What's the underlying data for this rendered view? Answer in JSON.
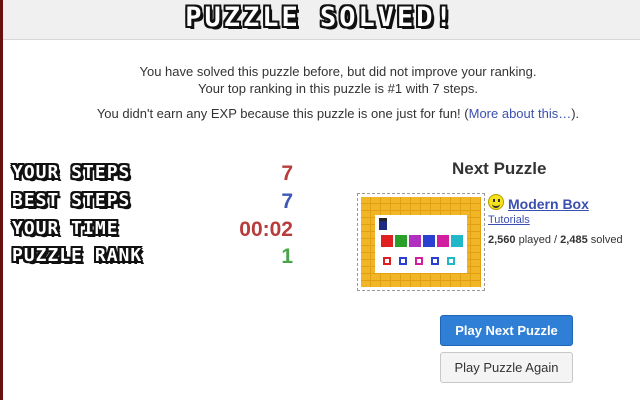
{
  "title": "PUZZLE SOLVED!",
  "messages": {
    "line1": "You have solved this puzzle before, but did not improve your ranking.",
    "line2": "Your top ranking in this puzzle is #1 with 7 steps.",
    "line3_prefix": "You didn't earn any EXP because this puzzle is one just for fun! (",
    "line3_link": "More about this…",
    "line3_suffix": ")."
  },
  "stats": [
    {
      "label": "YOUR STEPS",
      "value": "7",
      "color": "#b83c3c"
    },
    {
      "label": "BEST STEPS",
      "value": "7",
      "color": "#3f55b8"
    },
    {
      "label": "YOUR TIME",
      "value": "00:02",
      "color": "#b83c3c"
    },
    {
      "label": "PUZZLE RANK",
      "value": "1",
      "color": "#4aa24a"
    }
  ],
  "next_puzzle": {
    "heading": "Next Puzzle",
    "name": "Modern Box",
    "category": "Tutorials",
    "played_count": "2,560",
    "played_label": " played / ",
    "solved_count": "2,485",
    "solved_label": " solved",
    "icon": "smiley-icon"
  },
  "buttons": {
    "play_next": "Play Next Puzzle",
    "play_again": "Play Puzzle Again"
  },
  "colors": {
    "accent_blue": "#2f7fd6",
    "link": "#3a4fb0",
    "header_bg": "#f0f0f0",
    "left_strip": "#6b1010"
  }
}
